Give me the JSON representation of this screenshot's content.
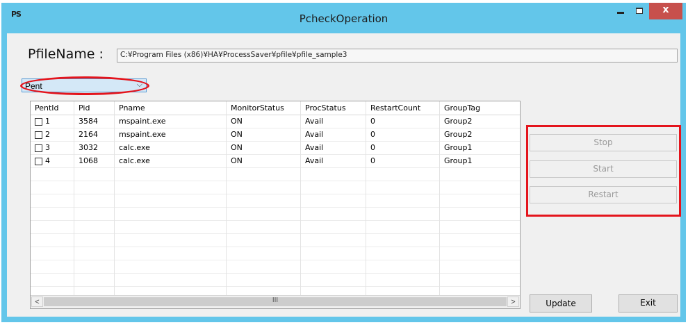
{
  "window": {
    "title": "PcheckOperation",
    "app_icon_text": "PS",
    "close_glyph": "x"
  },
  "pfile": {
    "label": "PfileName :",
    "value": "C:¥Program Files (x86)¥HA¥ProcessSaver¥pfile¥pfile_sample3"
  },
  "combo": {
    "value": "Pent",
    "arrow": "⌵"
  },
  "grid": {
    "columns": [
      "PentId",
      "Pid",
      "Pname",
      "MonitorStatus",
      "ProcStatus",
      "RestartCount",
      "GroupTag"
    ],
    "rows": [
      {
        "PentId": "1",
        "Pid": "3584",
        "Pname": "mspaint.exe",
        "MonitorStatus": "ON",
        "ProcStatus": "Avail",
        "RestartCount": "0",
        "GroupTag": "Group2"
      },
      {
        "PentId": "2",
        "Pid": "2164",
        "Pname": "mspaint.exe",
        "MonitorStatus": "ON",
        "ProcStatus": "Avail",
        "RestartCount": "0",
        "GroupTag": "Group2"
      },
      {
        "PentId": "3",
        "Pid": "3032",
        "Pname": "calc.exe",
        "MonitorStatus": "ON",
        "ProcStatus": "Avail",
        "RestartCount": "0",
        "GroupTag": "Group1"
      },
      {
        "PentId": "4",
        "Pid": "1068",
        "Pname": "calc.exe",
        "MonitorStatus": "ON",
        "ProcStatus": "Avail",
        "RestartCount": "0",
        "GroupTag": "Group1"
      }
    ],
    "scroll_left": "<",
    "scroll_right": ">",
    "scroll_grip": "III"
  },
  "actions": {
    "stop": "Stop",
    "start": "Start",
    "restart": "Restart",
    "update": "Update",
    "exit": "Exit"
  },
  "colors": {
    "title_bar": "#63c6ea",
    "highlight": "#e4141c",
    "close_button": "#c7504c"
  }
}
